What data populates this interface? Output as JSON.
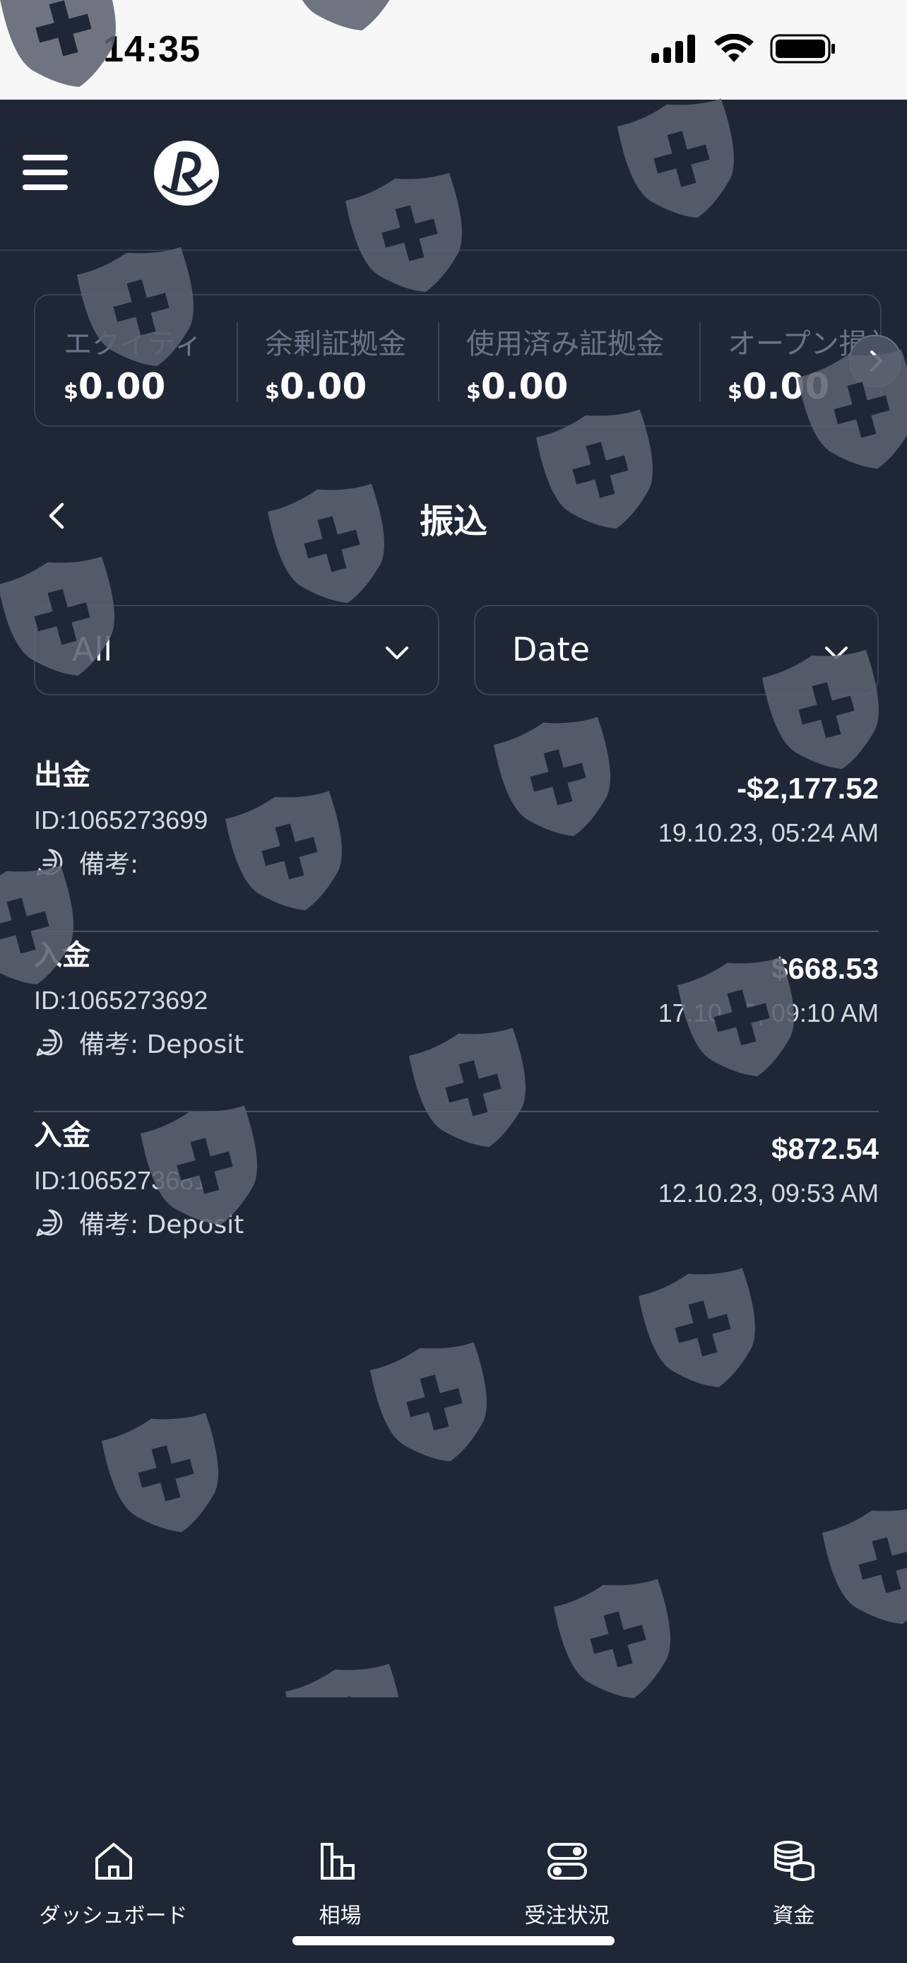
{
  "status_bar": {
    "time": "14:35"
  },
  "summary": {
    "metrics": [
      {
        "label": "エクイティ",
        "currency": "$",
        "value": "0.00"
      },
      {
        "label": "余剰証拠金",
        "currency": "$",
        "value": "0.00"
      },
      {
        "label": "使用済み証拠金",
        "currency": "$",
        "value": "0.00"
      },
      {
        "label": "オープン損益",
        "currency": "$",
        "value": "0.00"
      }
    ]
  },
  "page": {
    "title": "振込"
  },
  "filters": {
    "type_value": "All",
    "date_value": "Date"
  },
  "transactions": [
    {
      "type": "出金",
      "id": "ID:1065273699",
      "note": "備考:",
      "amount": "-$2,177.52",
      "datetime": "19.10.23, 05:24 AM"
    },
    {
      "type": "入金",
      "id": "ID:1065273692",
      "note": "備考: Deposit",
      "amount": "$668.53",
      "datetime": "17.10.23, 09:10 AM"
    },
    {
      "type": "入金",
      "id": "ID:1065273681",
      "note": "備考: Deposit",
      "amount": "$872.54",
      "datetime": "12.10.23, 09:53 AM"
    }
  ],
  "tabbar": {
    "items": [
      {
        "label": "ダッシュボード",
        "icon": "home-icon"
      },
      {
        "label": "相場",
        "icon": "bar-chart-icon"
      },
      {
        "label": "受注状況",
        "icon": "toggles-icon"
      },
      {
        "label": "資金",
        "icon": "coins-icon"
      }
    ]
  },
  "colors": {
    "background": "#1f2737",
    "border": "#3a4356",
    "muted_text": "#697387",
    "watermark": "#5c6270"
  }
}
